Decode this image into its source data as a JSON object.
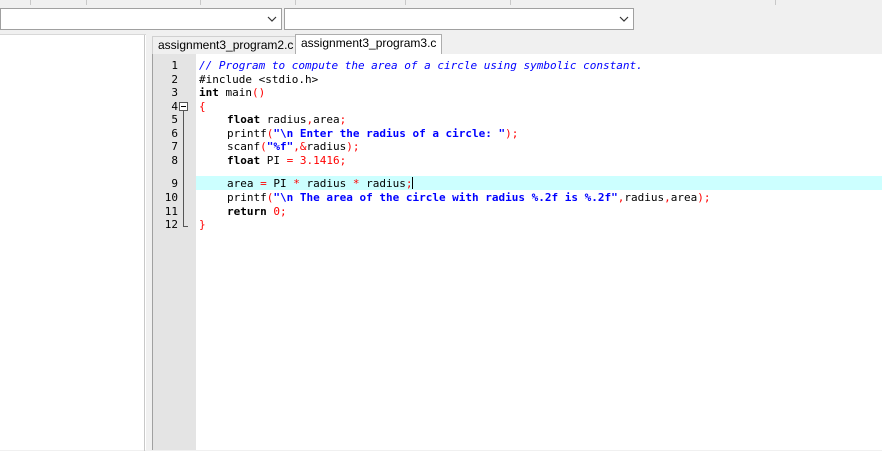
{
  "toolbar": {
    "combo1_value": "",
    "combo2_value": ""
  },
  "tabs": [
    {
      "label": "assignment3_program2.c",
      "active": false
    },
    {
      "label": "assignment3_program3.c",
      "active": true
    }
  ],
  "editor": {
    "current_line": 9,
    "lines": [
      {
        "n": "1"
      },
      {
        "n": "2"
      },
      {
        "n": "3"
      },
      {
        "n": "4"
      },
      {
        "n": "5"
      },
      {
        "n": "6"
      },
      {
        "n": "7"
      },
      {
        "n": "8"
      },
      {
        "n": "9"
      },
      {
        "n": "10"
      },
      {
        "n": "11"
      },
      {
        "n": "12"
      }
    ],
    "tokens": {
      "l1_comment": "// Program to compute the area of a circle using symbolic constant.",
      "l2_include": "#include <stdio.h>",
      "l3_kw": "int",
      "l3_rest": " main",
      "l3_paren": "()",
      "l4_brace": "{",
      "l5_kw": "float",
      "l5_rest": " radius",
      "l5_comma": ",",
      "l5_rest2": "area",
      "l5_semi": ";",
      "l6_fn": "printf",
      "l6_open": "(",
      "l6_str": "\"\\n Enter the radius of a circle: \"",
      "l6_close": ");",
      "l7_fn": "scanf",
      "l7_open": "(",
      "l7_str": "\"%f\"",
      "l7_comma": ",&",
      "l7_arg": "radius",
      "l7_close": ");",
      "l8_kw": "float",
      "l8_rest": " PI ",
      "l8_eq": "=",
      "l8_num": " 3.1416",
      "l8_semi": ";",
      "l9_a": "area ",
      "l9_eq": "=",
      "l9_b": " PI ",
      "l9_star1": "*",
      "l9_c": " radius ",
      "l9_star2": "*",
      "l9_d": " radius",
      "l9_semi": ";",
      "l10_fn": "printf",
      "l10_open": "(",
      "l10_str": "\"\\n The area of the circle with radius %.2f is %.2f\"",
      "l10_comma1": ",",
      "l10_arg1": "radius",
      "l10_comma2": ",",
      "l10_arg2": "area",
      "l10_close": ");",
      "l11_kw": "return",
      "l11_num": " 0",
      "l11_semi": ";",
      "l12_brace": "}"
    }
  },
  "icons": {
    "dropdown": "chevron-down-icon",
    "fold": "fold-minus-icon"
  }
}
